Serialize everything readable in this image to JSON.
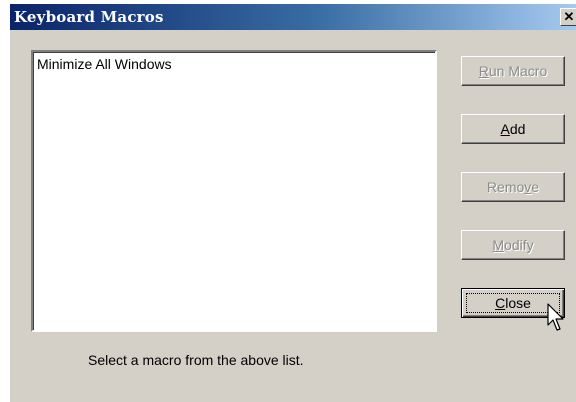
{
  "window": {
    "title": "Keyboard Macros",
    "close_glyph": "✕"
  },
  "macros": {
    "items": [
      "Minimize All Windows"
    ]
  },
  "buttons": {
    "run_macro": {
      "label_pre": "",
      "accel": "R",
      "label_post": "un Macro",
      "enabled": false
    },
    "add": {
      "label_pre": "",
      "accel": "A",
      "label_post": "dd",
      "enabled": true
    },
    "remove": {
      "label_pre": "Remo",
      "accel": "v",
      "label_post": "e",
      "enabled": false
    },
    "modify": {
      "label_pre": "",
      "accel": "M",
      "label_post": "odify",
      "enabled": false
    },
    "close": {
      "label_pre": "",
      "accel": "C",
      "label_post": "lose",
      "enabled": true,
      "default": true
    }
  },
  "status": {
    "text": "Select a macro from the above list."
  },
  "colors": {
    "face": "#d4d0c8",
    "title_start": "#0a246a",
    "title_end": "#a6caf0",
    "disabled_text": "#8c8c8c"
  },
  "icons": {
    "close": "close-icon",
    "pointer": "mouse-pointer-icon"
  }
}
